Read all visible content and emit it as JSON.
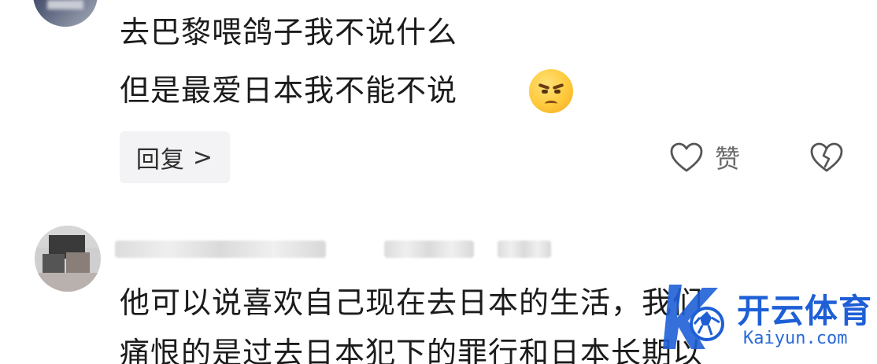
{
  "comment1": {
    "line1": "去巴黎喂鸽子我不说什么",
    "line2": "但是最爱日本我不能不说",
    "emoji": "annoyed-face-emoji",
    "reply_label": "回复",
    "reply_chevron": ">",
    "like_label": "赞",
    "like_icon": "heart-outline-icon",
    "dislike_icon": "broken-heart-icon"
  },
  "comment2": {
    "line1": "他可以说喜欢自己现在去日本的生活，我们",
    "line2": "痛恨的是过去日本犯下的罪行和日本长期以"
  },
  "watermark": {
    "name": "开云体育",
    "domain": "Kaiyun.com",
    "color": "#1e5fd6"
  }
}
